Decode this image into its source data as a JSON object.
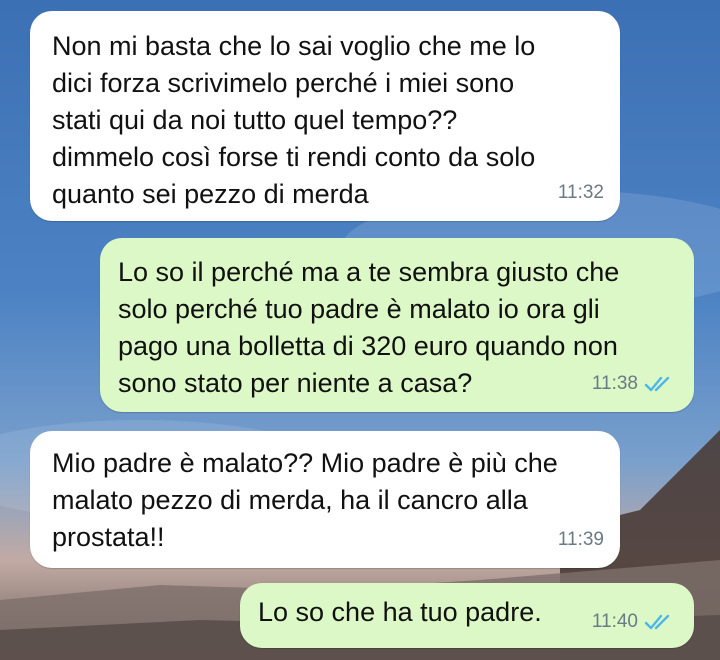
{
  "theme": {
    "incoming_bg": "#ffffff",
    "outgoing_bg": "#dcf8c6",
    "read_tick_color": "#4fb6ec",
    "timestamp_color": "#6b7a85"
  },
  "messages": [
    {
      "direction": "incoming",
      "text": "Non mi basta che lo sai voglio che me lo\ndici forza scrivimelo perché i miei sono\nstati qui da noi tutto quel tempo??\ndimmelo così forse ti rendi conto da solo\nquanto sei pezzo di merda",
      "time": "11:32"
    },
    {
      "direction": "outgoing",
      "text": "Lo so il perché ma a te sembra giusto che\nsolo perché tuo padre è malato io ora gli\npago una bolletta di 320 euro quando non\nsono stato per niente a casa?",
      "time": "11:38",
      "status_icon": "double-check-read-icon"
    },
    {
      "direction": "incoming",
      "text": "Mio padre è malato?? Mio padre è più che\nmalato pezzo di merda, ha il cancro alla\nprostata!!",
      "time": "11:39"
    },
    {
      "direction": "outgoing",
      "text": "Lo so che ha tuo padre.",
      "time": "11:40",
      "status_icon": "double-check-read-icon"
    }
  ]
}
